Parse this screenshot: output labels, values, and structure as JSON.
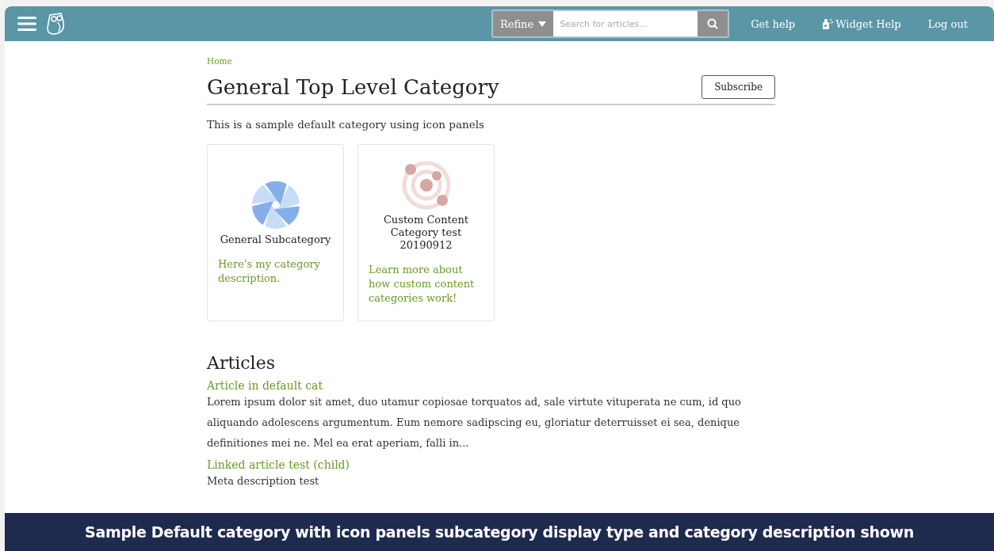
{
  "header": {
    "refine_label": "Refine",
    "search": {
      "placeholder": "Search for articles..."
    },
    "links": [
      {
        "label": "Get help",
        "kind": "text"
      },
      {
        "label": "Widget Help",
        "kind": "widget"
      },
      {
        "label": "Log out",
        "kind": "text"
      }
    ]
  },
  "breadcrumb": [
    "Home"
  ],
  "title": "General Top Level Category",
  "subscribe_button": "Subscribe",
  "description": "This is a sample default category using icon panels",
  "panels": [
    {
      "kind": "aperture",
      "title": "General Subcategory",
      "description": "Here's my category description."
    },
    {
      "kind": "orbit",
      "title": "Custom Content Category test 20190912",
      "description": "Learn more about how custom content categories work!"
    }
  ],
  "articles_heading": "Articles",
  "articles": [
    {
      "title": "Article in default cat",
      "summary": "Lorem ipsum dolor sit amet, duo utamur copiosae torquatos ad, sale virtute vituperata ne cum, id quo aliquando adolescens argumentum. Eum nemore sadipscing eu, gloriatur deterruisset ei sea, denique definitiones mei ne. Mel ea erat aperiam, falli in..."
    },
    {
      "title": "Linked article test (child)",
      "summary": "Meta description test"
    }
  ],
  "caption": "Sample Default category with icon panels subcategory display type and category description shown"
}
